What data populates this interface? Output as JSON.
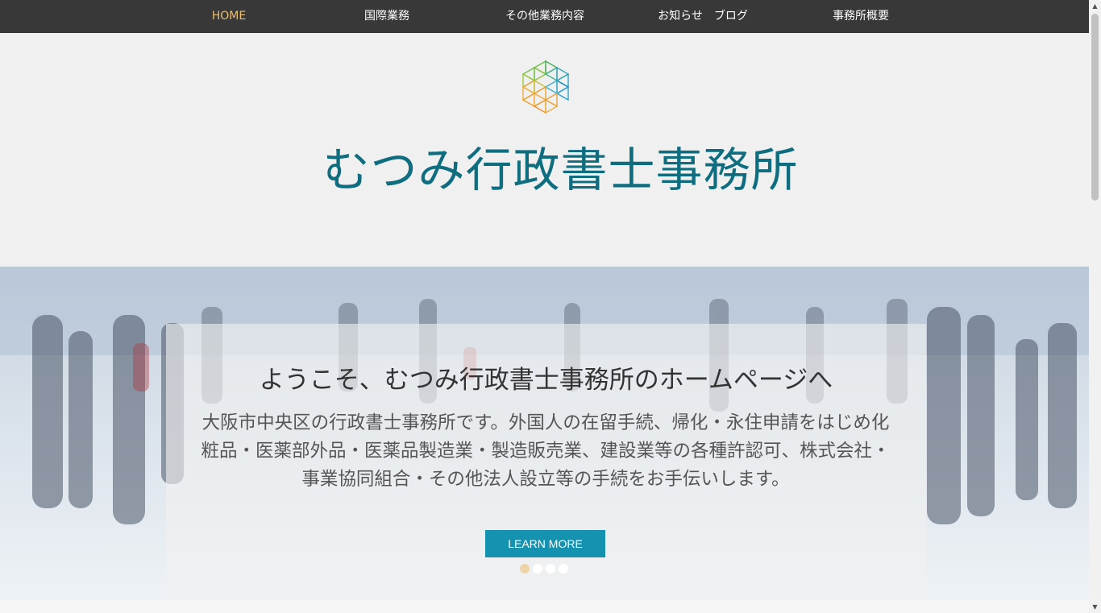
{
  "nav": {
    "items": [
      {
        "label": "HOME",
        "active": true
      },
      {
        "label": "国際業務"
      },
      {
        "label": "その他業務内容"
      },
      {
        "label": "お知らせ　ブログ"
      },
      {
        "label": "事務所概要"
      }
    ]
  },
  "header": {
    "title": "むつみ行政書士事務所",
    "logo_icon": "hexagon-triangles-logo"
  },
  "hero": {
    "heading": "ようこそ、むつみ行政書士事務所のホームページへ",
    "body": "大阪市中央区の行政書士事務所です。外国人の在留手続、帰化・永住申請をはじめ化粧品・医薬部外品・医薬品製造業・製造販売業、建設業等の各種許認可、株式会社・事業協同組合・その他法人設立等の手続をお手伝いします。",
    "button_label": "LEARN MORE",
    "slides": 4,
    "active_slide": 1
  },
  "colors": {
    "nav_bg": "#383838",
    "nav_active": "#e8c07a",
    "title": "#0f6d80",
    "button": "#1492b0"
  }
}
